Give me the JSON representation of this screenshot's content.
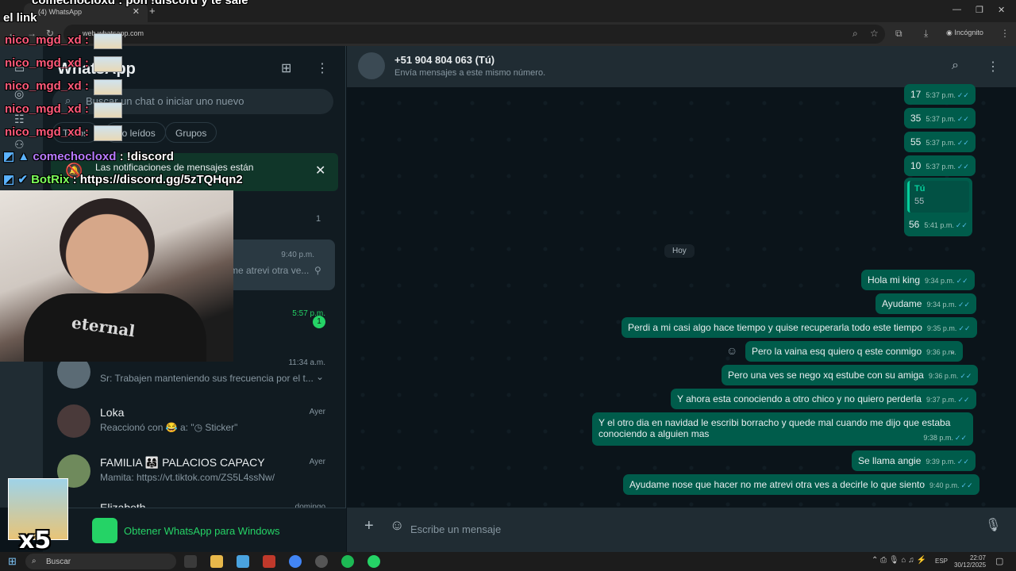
{
  "browser": {
    "tab_title": "(4) WhatsApp",
    "tab_badge": "4",
    "url": "web.whatsapp.com",
    "incognito_label": "Incógnito"
  },
  "left_panel": {
    "title": "WhatsApp",
    "search_placeholder": "Buscar un chat o iniciar uno nuevo",
    "filters": [
      "Todos",
      "No leídos",
      "Grupos"
    ],
    "notification_text": "Las notificaciones de mensajes están",
    "archived_count": "1",
    "chats": [
      {
        "name": "",
        "message": "me atrevi otra ve...",
        "time": "9:40 p.m."
      },
      {
        "name": "",
        "message": "",
        "time": "5:57 p.m.",
        "unread": "1"
      },
      {
        "name": "",
        "message": "Sr: Trabajen manteniendo sus frecuencia por el t...",
        "time": "11:34 a.m."
      },
      {
        "name": "Loka",
        "message": "Reaccionó con 😂 a: \"◷ Sticker\"",
        "time": "Ayer"
      },
      {
        "name": "FAMILIA 👨‍👩‍👧 PALACIOS CAPACY",
        "message": "Mamita: https://vt.tiktok.com/ZS5L4ssNw/",
        "time": "Ayer"
      },
      {
        "name": "Elizabeth",
        "message": "",
        "time": "domingo"
      }
    ],
    "get_app_label": "Obtener WhatsApp para Windows"
  },
  "chat": {
    "contact_name": "+51 904 804 063 (Tú)",
    "contact_sub": "Envía mensajes a este mismo número.",
    "day_divider": "Hoy",
    "quote_author": "Tú",
    "quote_text": "55",
    "messages": [
      {
        "text": "17",
        "time": "5:37 p.m."
      },
      {
        "text": "35",
        "time": "5:37 p.m."
      },
      {
        "text": "55",
        "time": "5:37 p.m."
      },
      {
        "text": "10",
        "time": "5:37 p.m."
      },
      {
        "text": "56",
        "time": "5:41 p.m."
      },
      {
        "text": "Hola mi king",
        "time": "9:34 p.m."
      },
      {
        "text": "Ayudame",
        "time": "9:34 p.m."
      },
      {
        "text": "Perdi a mi casi algo hace tiempo y quise recuperarla todo este tiempo",
        "time": "9:35 p.m."
      },
      {
        "text": "Pero la vaina esq quiero q este conmigo",
        "time": "9:36 p.m."
      },
      {
        "text": "Pero una ves se nego xq estube con su amiga",
        "time": "9:36 p.m."
      },
      {
        "text": "Y ahora esta conociendo a otro chico y no quiero perderla",
        "time": "9:37 p.m."
      },
      {
        "text": "Y el otro dia en navidad le escribi borracho y quede mal cuando me dijo que estaba",
        "text2": "conociendo a alguien mas",
        "time": "9:38 p.m."
      },
      {
        "text": "Se llama angie",
        "time": "9:39 p.m."
      },
      {
        "text": "Ayudame nose que hacer no me atrevi otra ves a decirle lo que siento",
        "time": "9:40 p.m."
      }
    ],
    "composer_placeholder": "Escribe un mensaje"
  },
  "taskbar": {
    "search_label": "Buscar",
    "lang": "ESP",
    "time": "22:07",
    "date": "30/12/2025"
  },
  "overlay": {
    "top_line": "comechocloxd : pon !discord y te sale",
    "top_line2": "el link",
    "repeat_user": "nico_mgd_xd :",
    "chat1_user": "comechocloxd",
    "chat1_msg": ": !discord",
    "chat2_user": "BotRix",
    "chat2_msg": ": https://discord.gg/5zTQHqn2",
    "shirt_print": "eternal",
    "combo": "x5"
  }
}
